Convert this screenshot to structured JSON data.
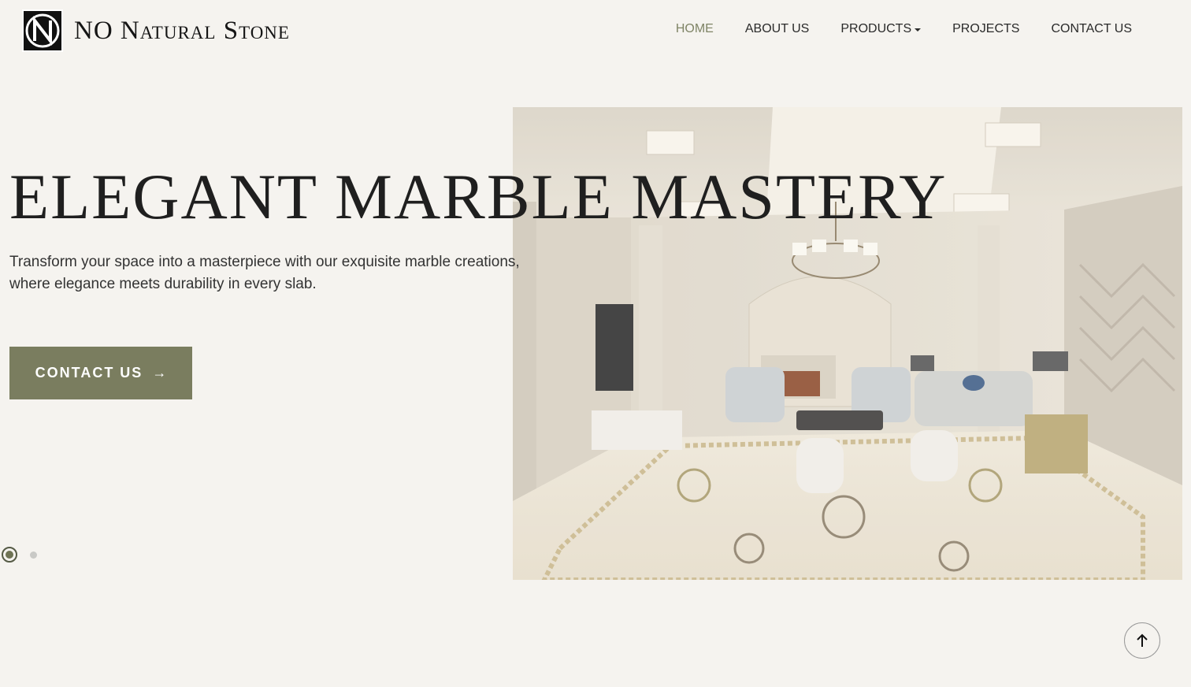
{
  "brand": {
    "name": "NO Natural Stone"
  },
  "nav": {
    "items": [
      {
        "label": "HOME"
      },
      {
        "label": "ABOUT US"
      },
      {
        "label": "PRODUCTS"
      },
      {
        "label": "PROJECTS"
      },
      {
        "label": "CONTACT US"
      }
    ]
  },
  "hero": {
    "title": "ELEGANT MARBLE MASTERY",
    "subtitle_line1": "Transform your space into a masterpiece with our exquisite marble creations,",
    "subtitle_line2": "where elegance meets durability in every slab.",
    "cta_label": "CONTACT US",
    "cta_arrow": "→",
    "image_icon": "luxury-marble-living-room-photo"
  },
  "slider": {
    "total_slides": 2,
    "active_index": 0
  },
  "scroll_top": {
    "icon": "arrow-up-icon"
  },
  "colors": {
    "background": "#f5f3ef",
    "accent": "#7a7d5f",
    "nav_active": "#7f8466",
    "text": "#1f1f1f"
  }
}
